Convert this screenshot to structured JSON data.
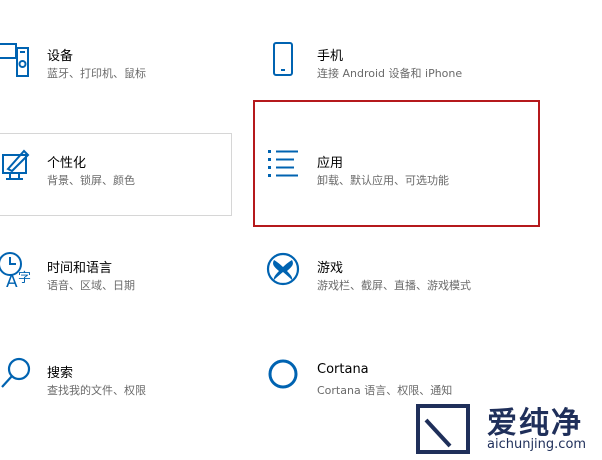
{
  "settings": [
    {
      "title": "设备",
      "subtitle": "蓝牙、打印机、鼠标",
      "icon": "devices-icon"
    },
    {
      "title": "手机",
      "subtitle": "连接 Android 设备和 iPhone",
      "icon": "phone-icon"
    },
    {
      "title": "个性化",
      "subtitle": "背景、锁屏、颜色",
      "icon": "personalization-icon"
    },
    {
      "title": "应用",
      "subtitle": "卸载、默认应用、可选功能",
      "icon": "apps-icon"
    },
    {
      "title": "时间和语言",
      "subtitle": "语音、区域、日期",
      "icon": "time-language-icon"
    },
    {
      "title": "游戏",
      "subtitle": "游戏栏、截屏、直播、游戏模式",
      "icon": "xbox-icon"
    },
    {
      "title": "搜索",
      "subtitle": "查找我的文件、权限",
      "icon": "search-icon"
    },
    {
      "title": "Cortana",
      "subtitle": "Cortana 语言、权限、通知",
      "icon": "cortana-icon"
    }
  ],
  "watermark": {
    "text": "爱纯净",
    "url": "aichunjing.com"
  },
  "colors": {
    "accent": "#0063b1",
    "highlight_border": "#b5191c"
  }
}
